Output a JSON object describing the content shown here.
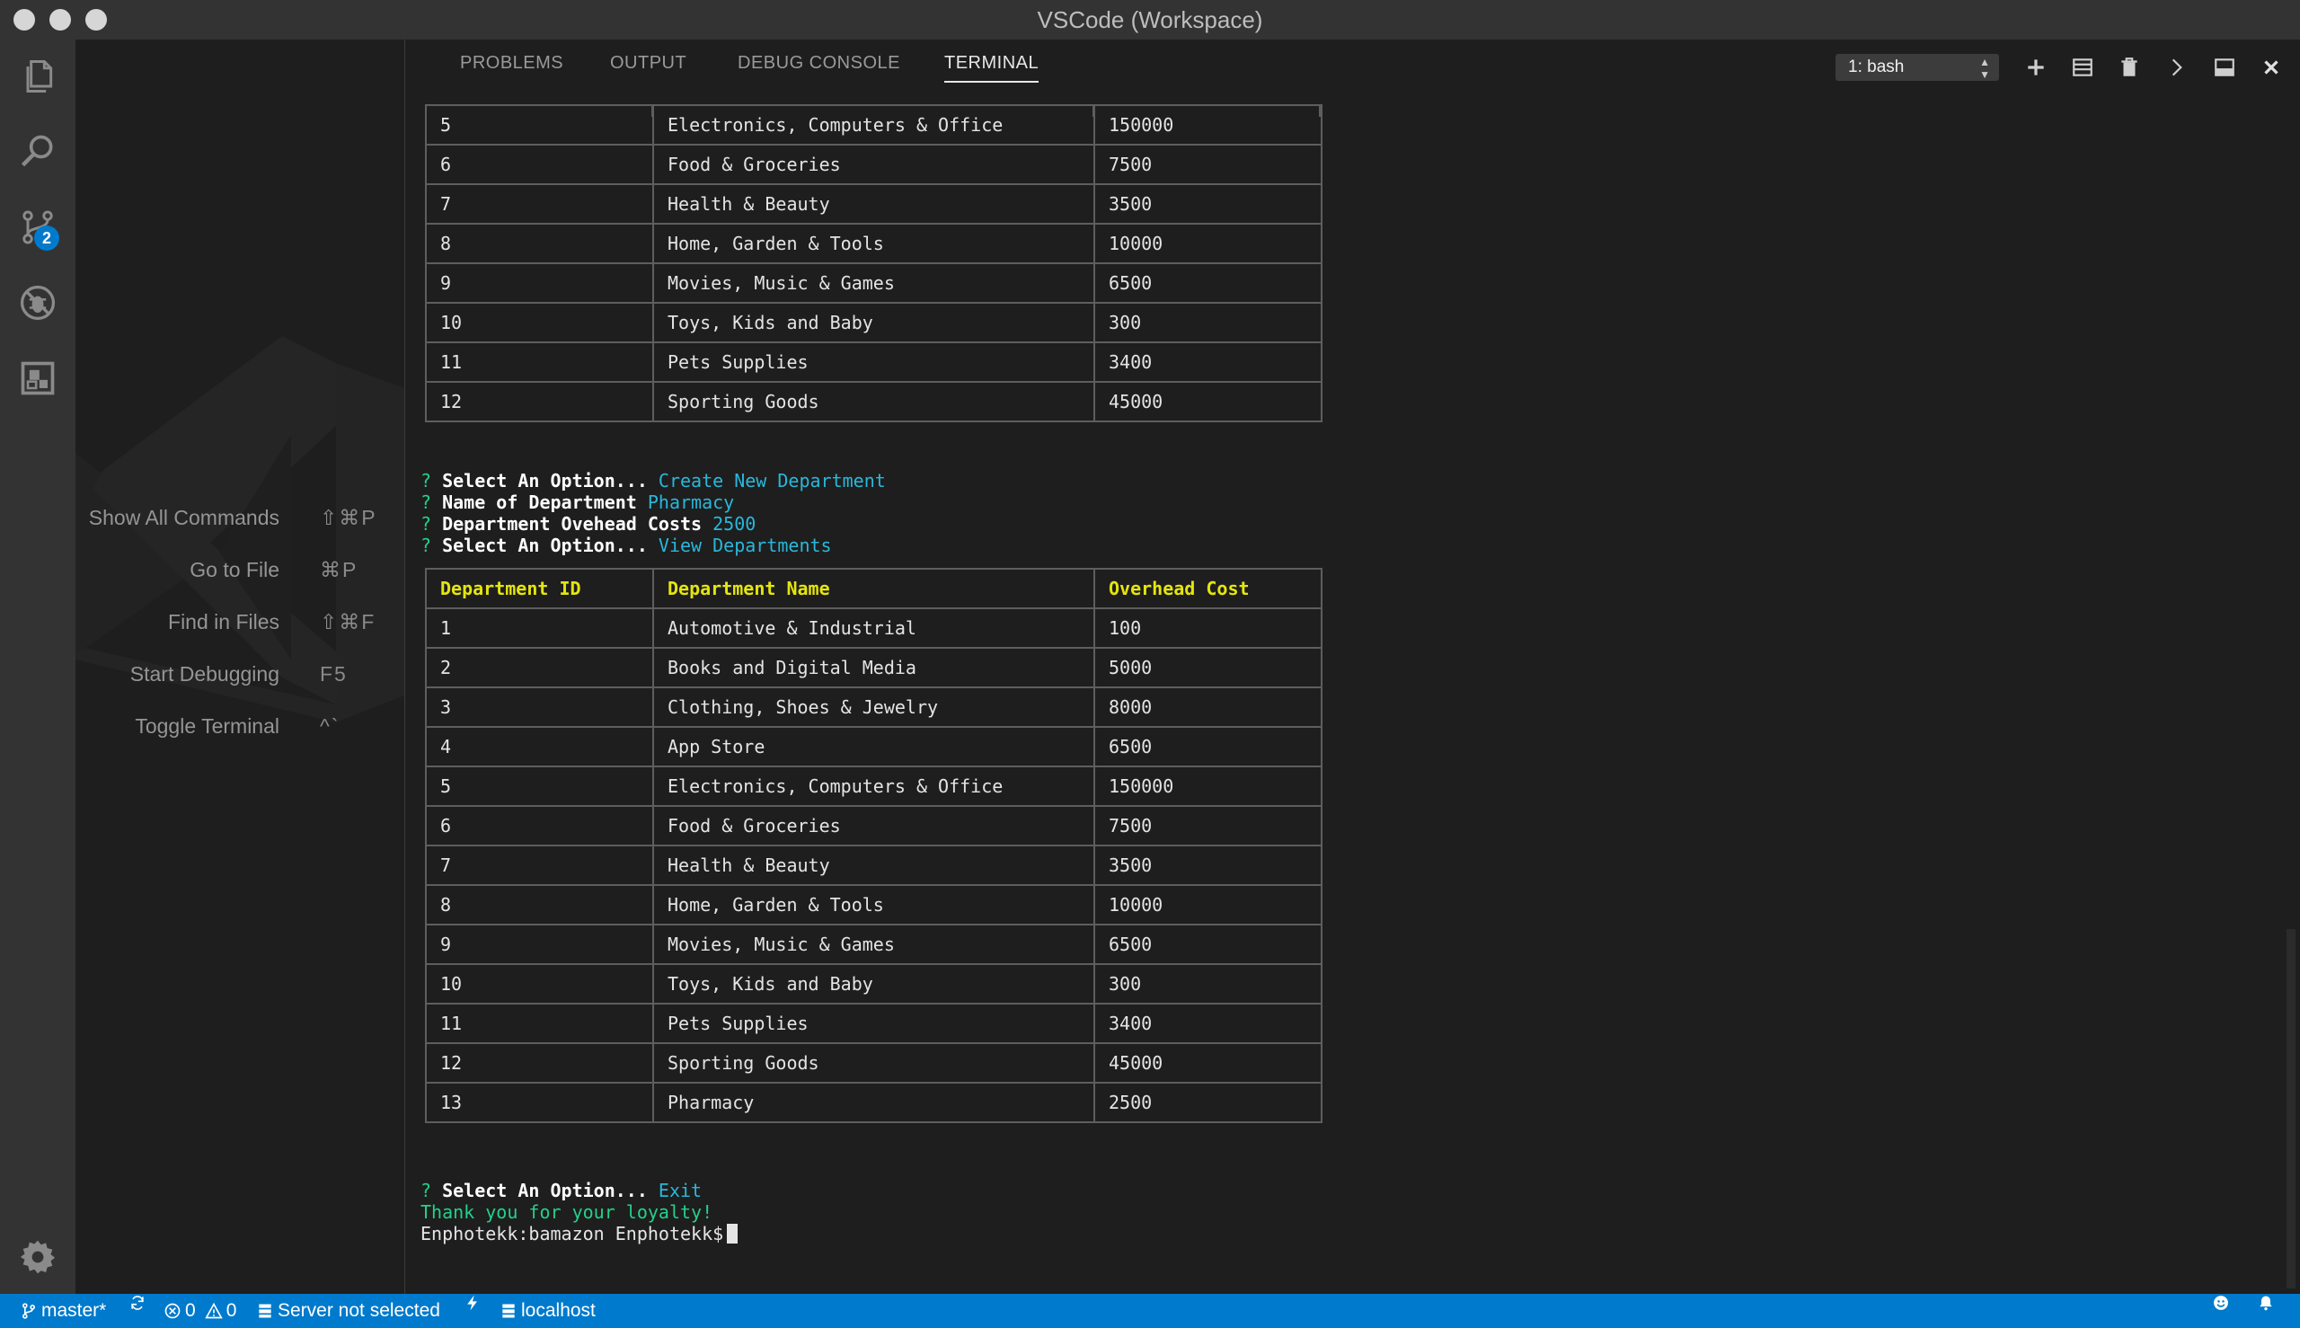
{
  "window": {
    "title": "VSCode (Workspace)"
  },
  "activity": {
    "scm_badge": "2"
  },
  "editor": {
    "shortcuts": [
      {
        "label": "Show All Commands",
        "key": "⇧⌘P"
      },
      {
        "label": "Go to File",
        "key": "⌘P"
      },
      {
        "label": "Find in Files",
        "key": "⇧⌘F"
      },
      {
        "label": "Start Debugging",
        "key": "F5"
      },
      {
        "label": "Toggle Terminal",
        "key": "^`"
      }
    ]
  },
  "panel": {
    "tabs": [
      "PROBLEMS",
      "OUTPUT",
      "DEBUG CONSOLE",
      "TERMINAL"
    ],
    "active_tab": "TERMINAL",
    "terminal_select": "1: bash",
    "icons": [
      "plus-icon",
      "split-icon",
      "trash-icon",
      "chevron-right-icon",
      "maximize-panel-icon",
      "close-icon"
    ]
  },
  "terminal": {
    "table1_rows": [
      [
        "5",
        "Electronics, Computers & Office",
        "150000"
      ],
      [
        "6",
        "Food & Groceries",
        "7500"
      ],
      [
        "7",
        "Health & Beauty",
        "3500"
      ],
      [
        "8",
        "Home, Garden & Tools",
        "10000"
      ],
      [
        "9",
        "Movies, Music & Games",
        "6500"
      ],
      [
        "10",
        "Toys, Kids and Baby",
        "300"
      ],
      [
        "11",
        "Pets Supplies",
        "3400"
      ],
      [
        "12",
        "Sporting Goods",
        "45000"
      ]
    ],
    "prompts": [
      {
        "mark": "?",
        "question": "Select An Option...",
        "answer": "Create New Department"
      },
      {
        "mark": "?",
        "question": "Name of Department",
        "answer": "Pharmacy"
      },
      {
        "mark": "?",
        "question": "Department Ovehead Costs",
        "answer": "2500"
      },
      {
        "mark": "?",
        "question": "Select An Option...",
        "answer": "View Departments"
      }
    ],
    "table2_headers": [
      "Department ID",
      "Department Name",
      "Overhead Cost"
    ],
    "table2_rows": [
      [
        "1",
        "Automotive & Industrial",
        "100"
      ],
      [
        "2",
        "Books and Digital Media",
        "5000"
      ],
      [
        "3",
        "Clothing, Shoes & Jewelry",
        "8000"
      ],
      [
        "4",
        "App Store",
        "6500"
      ],
      [
        "5",
        "Electronics, Computers & Office",
        "150000"
      ],
      [
        "6",
        "Food & Groceries",
        "7500"
      ],
      [
        "7",
        "Health & Beauty",
        "3500"
      ],
      [
        "8",
        "Home, Garden & Tools",
        "10000"
      ],
      [
        "9",
        "Movies, Music & Games",
        "6500"
      ],
      [
        "10",
        "Toys, Kids and Baby",
        "300"
      ],
      [
        "11",
        "Pets Supplies",
        "3400"
      ],
      [
        "12",
        "Sporting Goods",
        "45000"
      ],
      [
        "13",
        "Pharmacy",
        "2500"
      ]
    ],
    "final_prompt": {
      "mark": "?",
      "question": "Select An Option...",
      "answer": "Exit"
    },
    "thanks": "Thank you for your loyalty!",
    "shell_prompt": "Enphotekk:bamazon Enphotekk$"
  },
  "statusbar": {
    "branch": "master*",
    "errors": "0",
    "warnings": "0",
    "server": "Server not selected",
    "host": "localhost"
  },
  "colors": {
    "statusbar_bg": "#007acc",
    "terminal_yellow": "#e5e510",
    "terminal_cyan": "#29b8db",
    "terminal_green": "#23d18b"
  }
}
